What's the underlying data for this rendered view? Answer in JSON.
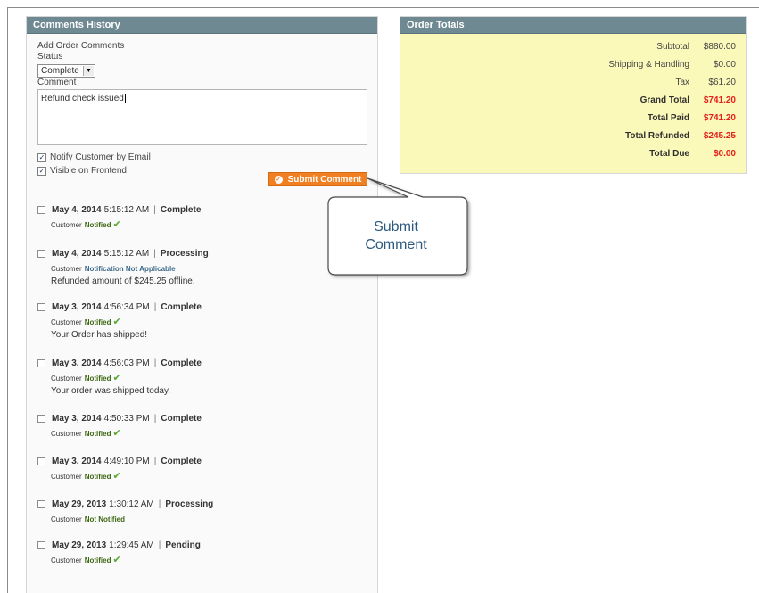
{
  "comments_panel": {
    "title": "Comments History",
    "add_label": "Add Order Comments",
    "status_label": "Status",
    "status_value": "Complete",
    "comment_label": "Comment",
    "comment_value": "Refund check issued",
    "notify_label": "Notify Customer by Email",
    "notify_checked": true,
    "visible_label": "Visible on Frontend",
    "visible_checked": true,
    "submit_label": "Submit Comment"
  },
  "history": [
    {
      "date": "May 4, 2014",
      "time": "5:15:12 AM",
      "status": "Complete",
      "notify_prefix": "Customer",
      "notify_state": "Notified",
      "comment": ""
    },
    {
      "date": "May 4, 2014",
      "time": "5:15:12 AM",
      "status": "Processing",
      "notify_prefix": "Customer",
      "notify_state": "Notification Not Applicable",
      "comment": "Refunded amount of $245.25 offline."
    },
    {
      "date": "May 3, 2014",
      "time": "4:56:34 PM",
      "status": "Complete",
      "notify_prefix": "Customer",
      "notify_state": "Notified",
      "comment": "Your Order has shipped!"
    },
    {
      "date": "May 3, 2014",
      "time": "4:56:03 PM",
      "status": "Complete",
      "notify_prefix": "Customer",
      "notify_state": "Notified",
      "comment": "Your order was shipped today."
    },
    {
      "date": "May 3, 2014",
      "time": "4:50:33 PM",
      "status": "Complete",
      "notify_prefix": "Customer",
      "notify_state": "Notified",
      "comment": ""
    },
    {
      "date": "May 3, 2014",
      "time": "4:49:10 PM",
      "status": "Complete",
      "notify_prefix": "Customer",
      "notify_state": "Notified",
      "comment": ""
    },
    {
      "date": "May 29, 2013",
      "time": "1:30:12 AM",
      "status": "Processing",
      "notify_prefix": "Customer",
      "notify_state": "Not Notified",
      "comment": ""
    },
    {
      "date": "May 29, 2013",
      "time": "1:29:45 AM",
      "status": "Pending",
      "notify_prefix": "Customer",
      "notify_state": "Notified",
      "comment": ""
    }
  ],
  "history_separator": "|",
  "totals_panel": {
    "title": "Order Totals",
    "rows": [
      {
        "label": "Subtotal",
        "value": "$880.00"
      },
      {
        "label": "Shipping & Handling",
        "value": "$0.00"
      },
      {
        "label": "Tax",
        "value": "$61.20"
      },
      {
        "label": "Grand Total",
        "value": "$741.20"
      },
      {
        "label": "Total Paid",
        "value": "$741.20"
      },
      {
        "label": "Total Refunded",
        "value": "$245.25"
      },
      {
        "label": "Total Due",
        "value": "$0.00"
      }
    ]
  },
  "callout": {
    "line1": "Submit",
    "line2": "Comment"
  },
  "colors": {
    "header_bg": "#6f8992",
    "submit_bg": "#f08021",
    "totals_bg": "#fbf9b9",
    "total_value_red": "#e4201b",
    "notified_green": "#3d6611",
    "callout_text": "#2a587f"
  },
  "icons": {
    "select_arrow": "triangle-down",
    "submit_icon": "ok-circle",
    "notified_check": "checkmark"
  }
}
